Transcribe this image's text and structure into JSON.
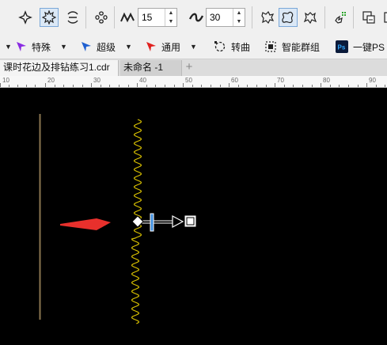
{
  "toolbar": {
    "width_value": "15",
    "freq_value": "30"
  },
  "toolbar2": {
    "special_label": "特殊",
    "super_label": "超级",
    "general_label": "通用",
    "convert_curve_label": "转曲",
    "smart_group_label": "智能群组",
    "one_key_ps_label": "一键PS"
  },
  "tabs": [
    {
      "label": "课时花边及排钻练习1.cdr"
    },
    {
      "label": "未命名 -1"
    }
  ],
  "ruler": {
    "labels": [
      "10",
      "20",
      "30",
      "40",
      "50",
      "60",
      "70",
      "80",
      "90"
    ]
  },
  "colors": {
    "zigzag": "#d8c000",
    "vertical_line": "#8a7650",
    "arrow": "#e8302c",
    "handle": "#ffffff",
    "slider_bar": "#3f8fe0"
  }
}
